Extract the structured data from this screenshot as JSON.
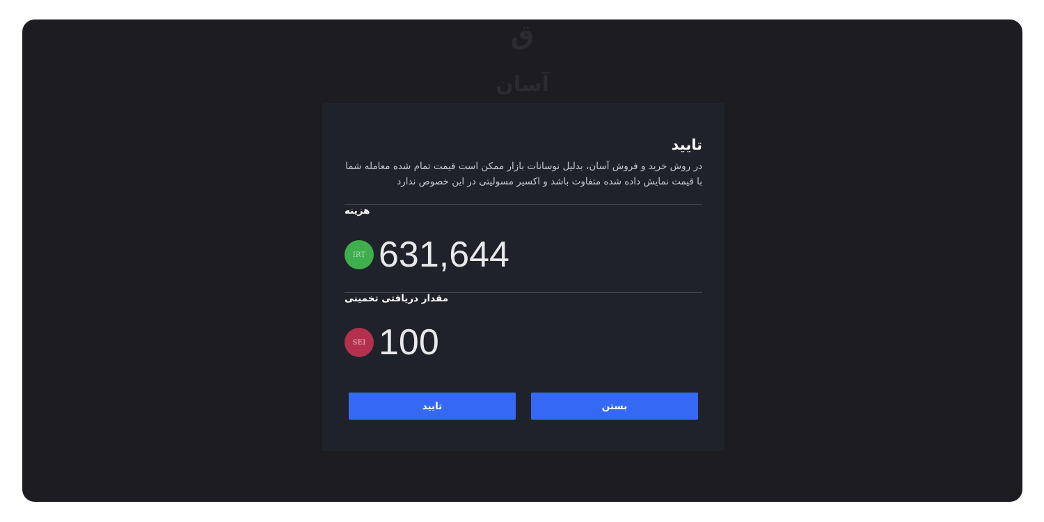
{
  "background": {
    "glyph": "ق",
    "word": "آسان"
  },
  "modal": {
    "title": "تایید",
    "description": "در روش خرید و فروش آسان، بدلیل نوسانات بازار ممکن است قیمت تمام شده معامله شما با قیمت نمایش داده شده متفاوت باشد و اکسیر مسولیتی در این خصوص ندارد",
    "cost": {
      "label": "هزینه",
      "currency": "IRT",
      "value": "631,644",
      "badge_color": "#3fae4c"
    },
    "estimated_receive": {
      "label": "مقدار دریافتی تخمینی",
      "currency": "SEI",
      "value": "100",
      "badge_color": "#b5304d"
    },
    "buttons": {
      "close_label": "بستن",
      "confirm_label": "تایید",
      "color": "#3569f5"
    }
  }
}
